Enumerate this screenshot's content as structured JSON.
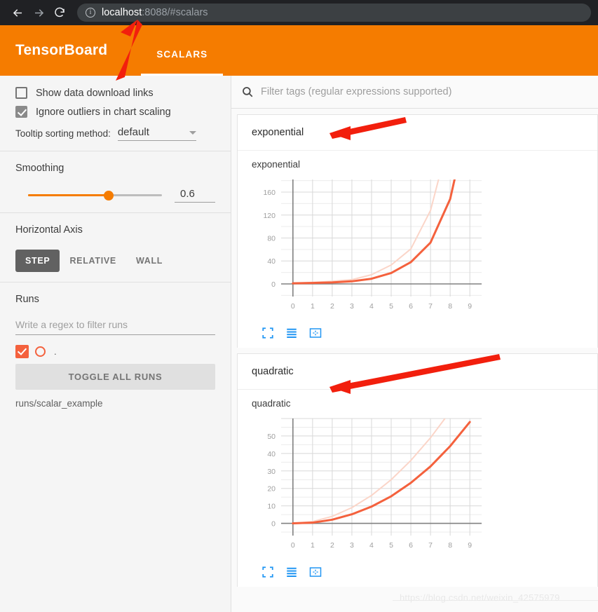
{
  "browser": {
    "back_icon": "arrow-left-icon",
    "forward_icon": "arrow-right-icon",
    "reload_icon": "reload-icon",
    "info_icon": "info-circle-icon",
    "url_host": "localhost",
    "url_rest": ":8088/#scalars"
  },
  "header": {
    "logo": "TensorBoard",
    "tabs": [
      {
        "label": "SCALARS",
        "active": true
      }
    ]
  },
  "sidebar": {
    "checkboxes": [
      {
        "label": "Show data download links",
        "checked": false
      },
      {
        "label": "Ignore outliers in chart scaling",
        "checked": true
      }
    ],
    "tooltip": {
      "label": "Tooltip sorting method:",
      "value": "default"
    },
    "smoothing": {
      "title": "Smoothing",
      "value": "0.6",
      "percent": 60
    },
    "horizontal_axis": {
      "title": "Horizontal Axis",
      "options": [
        "STEP",
        "RELATIVE",
        "WALL"
      ],
      "selected": "STEP"
    },
    "runs": {
      "title": "Runs",
      "filter_placeholder": "Write a regex to filter runs",
      "run_label": ".",
      "toggle_label": "TOGGLE ALL RUNS",
      "run_path": "runs/scalar_example"
    }
  },
  "content": {
    "search_placeholder": "Filter tags (regular expressions supported)",
    "search_icon": "search-icon",
    "tools": [
      "expand-icon",
      "data-table-icon",
      "fit-domain-icon"
    ]
  },
  "chart_data": [
    {
      "type": "line",
      "card_title": "exponential",
      "title": "exponential",
      "xlabel": "",
      "ylabel": "",
      "x": [
        0,
        1,
        2,
        3,
        4,
        5,
        6,
        7,
        8,
        9
      ],
      "xticks": [
        "0",
        "1",
        "2",
        "3",
        "4",
        "5",
        "6",
        "7",
        "8",
        "9"
      ],
      "yticks": [
        "0",
        "40",
        "80",
        "120",
        "160"
      ],
      "xlim": [
        -0.6,
        9.6
      ],
      "ylim": [
        -22,
        182
      ],
      "grid": true,
      "legend": "none",
      "series": [
        {
          "name": "raw",
          "color": "#fbd5c8",
          "width": 2,
          "values": [
            1,
            2.7,
            4.5,
            7.4,
            16,
            33,
            61,
            128,
            260,
            420
          ]
        },
        {
          "name": "smoothed",
          "color": "#f4613d",
          "width": 3,
          "values": [
            1,
            1.6,
            2.6,
            4.5,
            9,
            19,
            38,
            72,
            148,
            300
          ]
        }
      ]
    },
    {
      "type": "line",
      "card_title": "quadratic",
      "title": "quadratic",
      "xlabel": "",
      "ylabel": "",
      "x": [
        0,
        1,
        2,
        3,
        4,
        5,
        6,
        7,
        8,
        9
      ],
      "xticks": [
        "0",
        "1",
        "2",
        "3",
        "4",
        "5",
        "6",
        "7",
        "8",
        "9"
      ],
      "yticks": [
        "0",
        "10",
        "20",
        "30",
        "40",
        "50"
      ],
      "xlim": [
        -0.6,
        9.6
      ],
      "ylim": [
        -7,
        60
      ],
      "grid": true,
      "legend": "none",
      "series": [
        {
          "name": "raw",
          "color": "#fbd5c8",
          "width": 2,
          "values": [
            0,
            1,
            4,
            9,
            16,
            25,
            36,
            49,
            64,
            81
          ]
        },
        {
          "name": "smoothed",
          "color": "#f4613d",
          "width": 3,
          "values": [
            0,
            0.4,
            2.1,
            5.2,
            9.6,
            15.5,
            23.2,
            32.6,
            44.2,
            58
          ]
        }
      ]
    }
  ],
  "watermark": "https://blog.csdn.net/weixin_42575979"
}
